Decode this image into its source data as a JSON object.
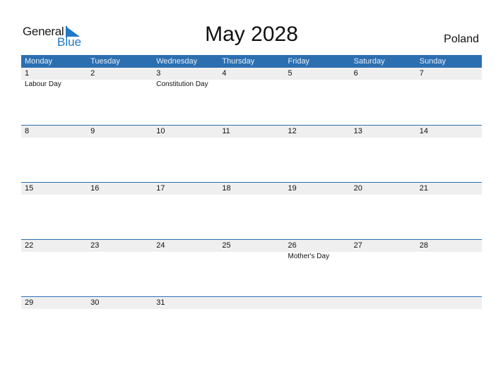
{
  "logo": {
    "word1": "General",
    "word2": "Blue",
    "icon": "flag-triangle-icon"
  },
  "title": "May 2028",
  "country": "Poland",
  "colors": {
    "header_bg": "#2c6fb1",
    "date_strip": "#efefef",
    "brand_blue": "#1f78c8"
  },
  "weekdays": [
    "Monday",
    "Tuesday",
    "Wednesday",
    "Thursday",
    "Friday",
    "Saturday",
    "Sunday"
  ],
  "weeks": [
    [
      {
        "day": "1",
        "holiday": "Labour Day"
      },
      {
        "day": "2",
        "holiday": ""
      },
      {
        "day": "3",
        "holiday": "Constitution Day"
      },
      {
        "day": "4",
        "holiday": ""
      },
      {
        "day": "5",
        "holiday": ""
      },
      {
        "day": "6",
        "holiday": ""
      },
      {
        "day": "7",
        "holiday": ""
      }
    ],
    [
      {
        "day": "8",
        "holiday": ""
      },
      {
        "day": "9",
        "holiday": ""
      },
      {
        "day": "10",
        "holiday": ""
      },
      {
        "day": "11",
        "holiday": ""
      },
      {
        "day": "12",
        "holiday": ""
      },
      {
        "day": "13",
        "holiday": ""
      },
      {
        "day": "14",
        "holiday": ""
      }
    ],
    [
      {
        "day": "15",
        "holiday": ""
      },
      {
        "day": "16",
        "holiday": ""
      },
      {
        "day": "17",
        "holiday": ""
      },
      {
        "day": "18",
        "holiday": ""
      },
      {
        "day": "19",
        "holiday": ""
      },
      {
        "day": "20",
        "holiday": ""
      },
      {
        "day": "21",
        "holiday": ""
      }
    ],
    [
      {
        "day": "22",
        "holiday": ""
      },
      {
        "day": "23",
        "holiday": ""
      },
      {
        "day": "24",
        "holiday": ""
      },
      {
        "day": "25",
        "holiday": ""
      },
      {
        "day": "26",
        "holiday": "Mother's Day"
      },
      {
        "day": "27",
        "holiday": ""
      },
      {
        "day": "28",
        "holiday": ""
      }
    ],
    [
      {
        "day": "29",
        "holiday": ""
      },
      {
        "day": "30",
        "holiday": ""
      },
      {
        "day": "31",
        "holiday": ""
      },
      {
        "day": "",
        "holiday": ""
      },
      {
        "day": "",
        "holiday": ""
      },
      {
        "day": "",
        "holiday": ""
      },
      {
        "day": "",
        "holiday": ""
      }
    ]
  ]
}
